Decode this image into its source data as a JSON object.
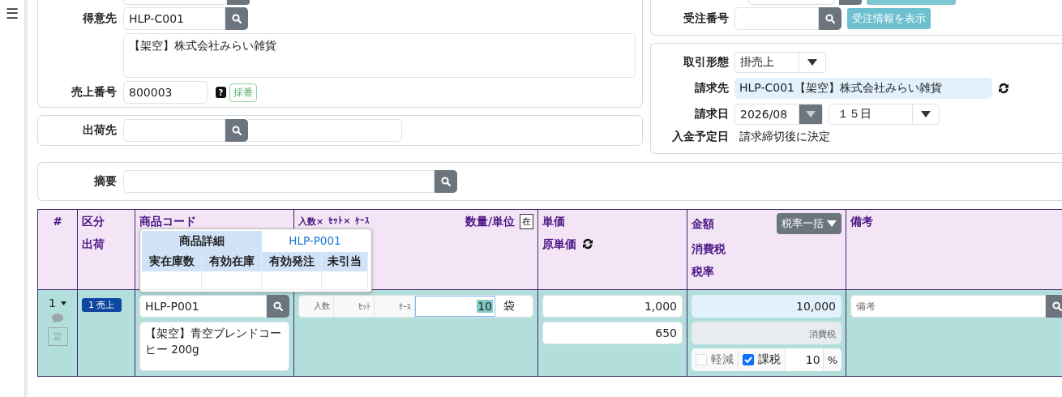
{
  "menu_button": "☰",
  "customer_panel": {
    "customer": {
      "label": "得意先",
      "code": "HLP-C001",
      "name": "【架空】株式会社みらい雑貨"
    },
    "sales_number": {
      "label": "売上番号",
      "value": "800003",
      "help": "?",
      "button": "採番"
    }
  },
  "shipping_panel": {
    "label": "出荷先"
  },
  "order_panel": {
    "label": "受注番号",
    "button": "受注情報を表示"
  },
  "billing_panel": {
    "transaction_type": {
      "label": "取引形態",
      "value": "掛売上"
    },
    "bill_to": {
      "label": "請求先",
      "value": "HLP-C001【架空】株式会社みらい雑貨"
    },
    "billing_date": {
      "label": "請求日",
      "month": "2026/08",
      "day": "１５日"
    },
    "payment_date": {
      "label": "入金予定日",
      "value": "請求締切後に決定"
    }
  },
  "memo": {
    "label": "摘要"
  },
  "table": {
    "header": {
      "number": "#",
      "category": [
        "区分",
        "出荷"
      ],
      "product_code": "商品コード",
      "quantity": {
        "parts": [
          "入数×",
          "ｾｯﾄ×",
          "ｹｰｽ"
        ],
        "label": "数量/単位",
        "stock_button": "在"
      },
      "price": [
        "単価",
        "原単価"
      ],
      "amount": {
        "lines": [
          "金額",
          "消費税",
          "税率"
        ],
        "button": "税率一括"
      },
      "remarks": "備考"
    },
    "popover": {
      "title": "商品詳細",
      "code": "HLP-P001",
      "columns": [
        "実在庫数",
        "有効在庫",
        "有効発注",
        "未引当"
      ]
    },
    "rows": [
      {
        "number": "1",
        "fixed_button": "定",
        "category": "1 売上",
        "product_code": "HLP-P001",
        "product_name": "【架空】青空ブレンドコーヒー 200g",
        "qty_placeholders": [
          "入数",
          "ｾｯﾄ",
          "ｹｰｽ"
        ],
        "quantity": "10",
        "unit": "袋",
        "unit_price": "1,000",
        "cost_price": "650",
        "amount": "10,000",
        "tax_placeholder": "消費税",
        "reduced": {
          "label": "軽減",
          "checked": false
        },
        "taxable": {
          "label": "課税",
          "checked": true
        },
        "tax_rate": "10",
        "percent": "%",
        "remarks_placeholder": "備考"
      }
    ]
  }
}
